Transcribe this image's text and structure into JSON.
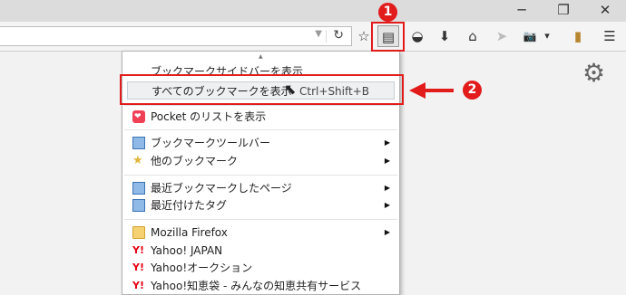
{
  "window": {
    "minimize_glyph": "─",
    "maximize_glyph": "❐",
    "close_glyph": "✕"
  },
  "toolbar": {
    "url_value": "",
    "url_dropdown_glyph": "▼",
    "reload_glyph": "↻",
    "buttons": [
      {
        "name": "bookmark-star-button",
        "glyph": "☆"
      },
      {
        "name": "pocket-button",
        "glyph": "◒"
      },
      {
        "name": "downloads-button",
        "glyph": "⬇"
      },
      {
        "name": "home-button",
        "glyph": "⌂"
      },
      {
        "name": "send-tab-button",
        "glyph": "➤"
      },
      {
        "name": "screenshot-button",
        "glyph": "📷"
      },
      {
        "name": "screenshot-dropdown-button",
        "glyph": "▾"
      },
      {
        "name": "reading-list-button",
        "glyph": "▮"
      },
      {
        "name": "hamburger-menu-button",
        "glyph": "☰"
      }
    ],
    "bookmarks_menu_glyph": "▤"
  },
  "menu": {
    "scroll_up_glyph": "▲",
    "items": [
      {
        "label": "ブックマークサイドバーを表示",
        "icon": "none"
      },
      {
        "label": "すべてのブックマークを表示",
        "shortcut": "Ctrl+Shift+B",
        "icon": "none"
      },
      {
        "label": "Pocket のリストを表示",
        "icon": "pocket-icon"
      },
      {
        "label": "ブックマークツールバー",
        "icon": "bookmarks-toolbar-icon",
        "submenu": true
      },
      {
        "label": "他のブックマーク",
        "icon": "unsorted-bookmarks-icon",
        "submenu": true
      },
      {
        "label": "最近ブックマークしたページ",
        "icon": "recent-bookmarks-icon",
        "submenu": true
      },
      {
        "label": "最近付けたタグ",
        "icon": "recent-tags-icon",
        "submenu": true
      },
      {
        "label": "Mozilla Firefox",
        "icon": "folder-icon",
        "submenu": true
      },
      {
        "label": "Yahoo! JAPAN",
        "icon": "yahoo-icon"
      },
      {
        "label": "Yahoo!オークション",
        "icon": "yahoo-icon"
      },
      {
        "label": "Yahoo!知恵袋 - みんなの知恵共有サービス",
        "icon": "yahoo-icon"
      }
    ],
    "submenu_arrow": "▶",
    "yahoo_icon_text": "Y!"
  },
  "annotations": {
    "badge_1": "1",
    "badge_2": "2",
    "accent": "#e21b1b"
  }
}
